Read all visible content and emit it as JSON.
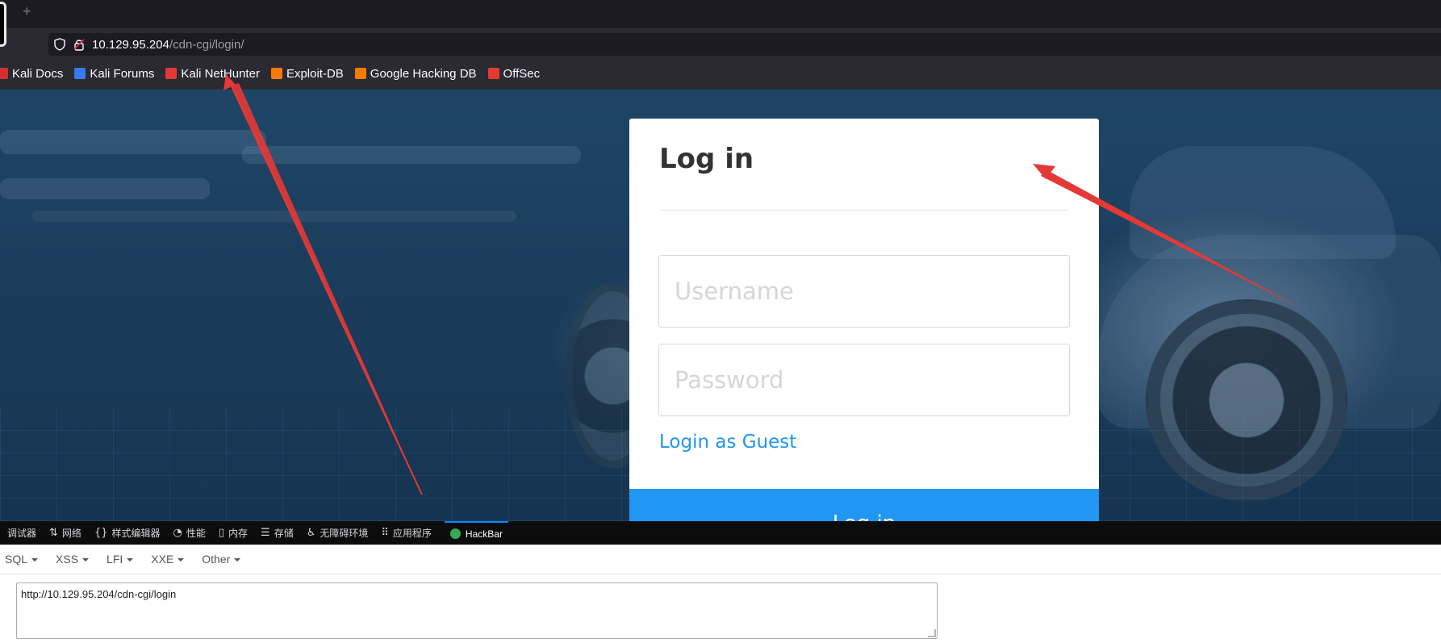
{
  "browser": {
    "url_host": "10.129.95.204",
    "url_path": "/cdn-cgi/login/",
    "newtab_label": "+"
  },
  "bookmarks": [
    {
      "label": "Kali Docs",
      "icon": "kali-docs-icon",
      "color": "#d32f2f"
    },
    {
      "label": "Kali Forums",
      "icon": "kali-forums-icon",
      "color": "#367bf0"
    },
    {
      "label": "Kali NetHunter",
      "icon": "nethunter-icon",
      "color": "#e53935"
    },
    {
      "label": "Exploit-DB",
      "icon": "exploit-db-icon",
      "color": "#f57c00"
    },
    {
      "label": "Google Hacking DB",
      "icon": "ghdb-icon",
      "color": "#f57c00"
    },
    {
      "label": "OffSec",
      "icon": "offsec-icon",
      "color": "#e53935"
    }
  ],
  "login": {
    "title": "Log in",
    "username_placeholder": "Username",
    "password_placeholder": "Password",
    "guest_link": "Login as Guest",
    "submit_label": "Log in",
    "accent": "#2196f3"
  },
  "devtools": {
    "tabs": [
      {
        "label": "调试器",
        "icon": "debugger-icon",
        "glyph": ""
      },
      {
        "label": "网络",
        "icon": "network-icon",
        "glyph": "⇅"
      },
      {
        "label": "样式编辑器",
        "icon": "style-editor-icon",
        "glyph": "{}"
      },
      {
        "label": "性能",
        "icon": "performance-icon",
        "glyph": "◔"
      },
      {
        "label": "内存",
        "icon": "memory-icon",
        "glyph": "▯"
      },
      {
        "label": "存储",
        "icon": "storage-icon",
        "glyph": "☰"
      },
      {
        "label": "无障碍环境",
        "icon": "accessibility-icon",
        "glyph": "♿"
      },
      {
        "label": "应用程序",
        "icon": "application-icon",
        "glyph": "⠿"
      },
      {
        "label": "HackBar",
        "icon": "hackbar-icon",
        "glyph": ""
      }
    ]
  },
  "hackbar": {
    "menus": [
      "SQL",
      "XSS",
      "LFI",
      "XXE",
      "Other"
    ],
    "url_value": "http://10.129.95.204/cdn-cgi/login"
  }
}
